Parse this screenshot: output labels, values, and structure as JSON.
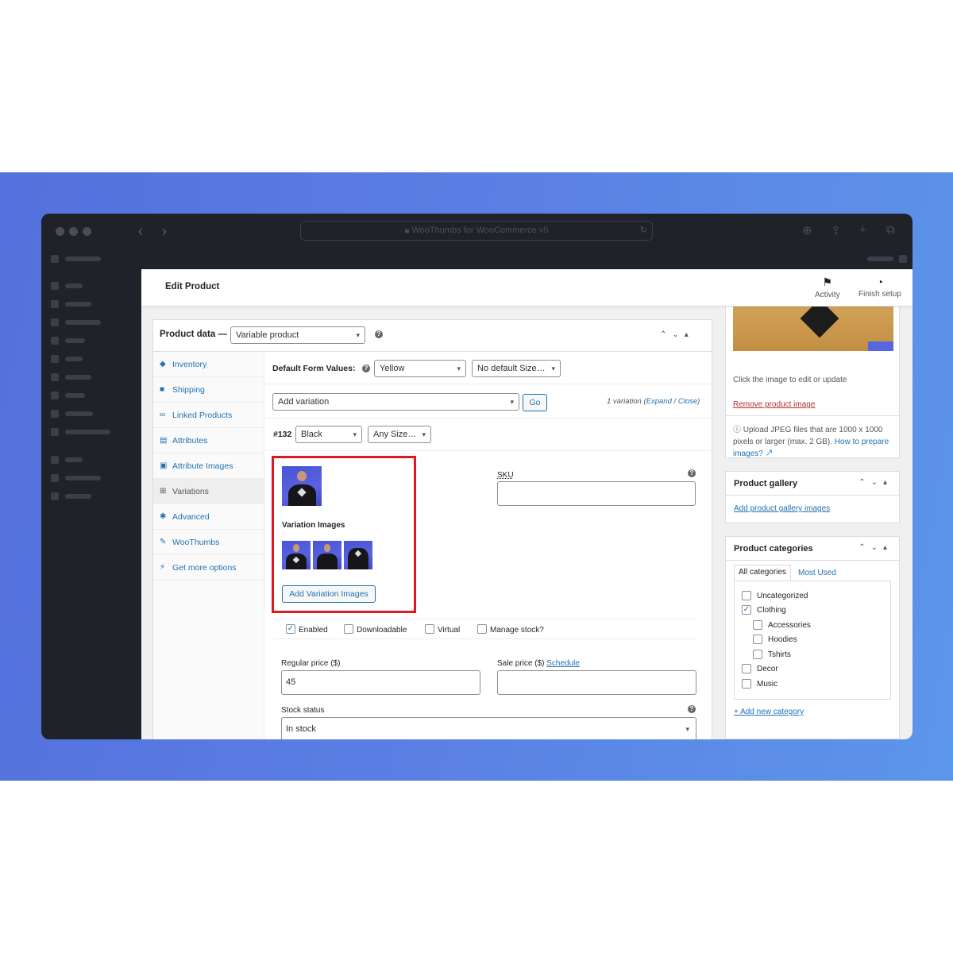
{
  "browser": {
    "url_title": "WooThumbs for WooCommerce v5",
    "lock_icon": "lock-icon",
    "reload_icon": "reload-icon"
  },
  "admin": {
    "page_title": "Edit Product",
    "activity_label": "Activity",
    "finish_setup_label": "Finish setup"
  },
  "product_data": {
    "label": "Product data —",
    "type": "Variable product",
    "tabs": [
      {
        "label": "Inventory",
        "icon": "tag-icon"
      },
      {
        "label": "Shipping",
        "icon": "truck-icon"
      },
      {
        "label": "Linked Products",
        "icon": "link-icon"
      },
      {
        "label": "Attributes",
        "icon": "list-icon"
      },
      {
        "label": "Attribute Images",
        "icon": "image-icon"
      },
      {
        "label": "Variations",
        "icon": "grid-icon"
      },
      {
        "label": "Advanced",
        "icon": "gear-icon"
      },
      {
        "label": "WooThumbs",
        "icon": "wrench-icon"
      },
      {
        "label": "Get more options",
        "icon": "plugin-icon"
      }
    ],
    "default_form_values_label": "Default Form Values:",
    "default_color": "Yellow",
    "default_size": "No default Size…",
    "add_variation": "Add variation",
    "go_label": "Go",
    "variation_count": "1 variation",
    "expand_label": "Expand",
    "close_label": "Close",
    "variation_id": "#132",
    "variation_color": "Black",
    "variation_size": "Any Size…",
    "variation_images_label": "Variation Images",
    "add_variation_images": "Add Variation Images",
    "sku_label": "SKU",
    "enabled_label": "Enabled",
    "downloadable_label": "Downloadable",
    "virtual_label": "Virtual",
    "manage_stock_label": "Manage stock?",
    "regular_price_label": "Regular price ($)",
    "regular_price_value": "45",
    "sale_price_label": "Sale price ($)",
    "schedule_label": "Schedule",
    "stock_status_label": "Stock status",
    "stock_status_value": "In stock"
  },
  "product_image": {
    "hint": "Click the image to edit or update",
    "remove_label": "Remove product image",
    "upload_note": "Upload JPEG files that are 1000 x 1000 pixels or larger (max. 2 GB).",
    "how_to_link": "How to prepare images?"
  },
  "gallery": {
    "title": "Product gallery",
    "add_link": "Add product gallery images"
  },
  "categories": {
    "title": "Product categories",
    "tab_all": "All categories",
    "tab_most_used": "Most Used",
    "items": [
      {
        "label": "Uncategorized",
        "checked": false,
        "child": false
      },
      {
        "label": "Clothing",
        "checked": true,
        "child": false
      },
      {
        "label": "Accessories",
        "checked": false,
        "child": true
      },
      {
        "label": "Hoodies",
        "checked": false,
        "child": true
      },
      {
        "label": "Tshirts",
        "checked": false,
        "child": true
      },
      {
        "label": "Decor",
        "checked": false,
        "child": false
      },
      {
        "label": "Music",
        "checked": false,
        "child": false
      }
    ],
    "add_new": "+ Add new category"
  },
  "colors": {
    "accent": "#2271b1",
    "highlight_box": "#e3161d",
    "window": "#1f2229"
  }
}
